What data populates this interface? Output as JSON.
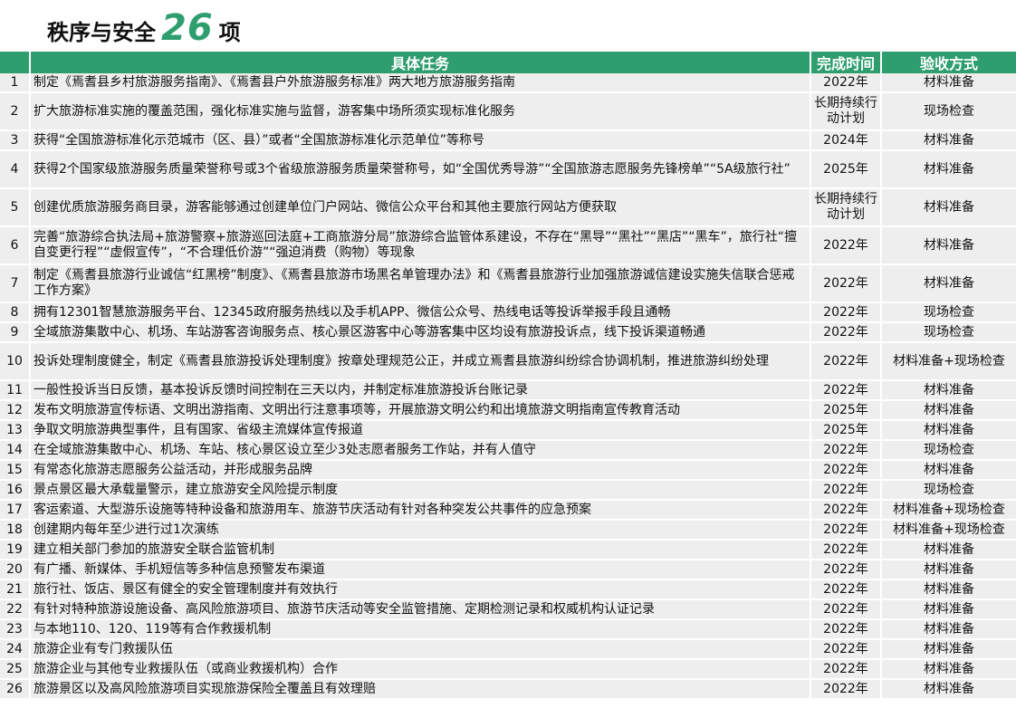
{
  "title": {
    "prefix": "秩序与安全",
    "number": "26",
    "suffix": "项"
  },
  "table": {
    "headers": {
      "index": "",
      "task": "具体任务",
      "time": "完成时间",
      "method": "验收方式"
    },
    "rows": [
      {
        "index": "1",
        "task": "制定《焉耆县乡村旅游服务指南》、《焉耆县户外旅游服务标准》两大地方旅游服务指南",
        "time": "2022年",
        "method": "材料准备"
      },
      {
        "index": "2",
        "task": "扩大旅游标准实施的覆盖范围，强化标准实施与监督，游客集中场所须实现标准化服务",
        "time": "长期持续行动计划",
        "method": "现场检查"
      },
      {
        "index": "3",
        "task": "获得“全国旅游标准化示范城市（区、县）”或者“全国旅游标准化示范单位”等称号",
        "time": "2024年",
        "method": "材料准备"
      },
      {
        "index": "4",
        "task": "获得2个国家级旅游服务质量荣誉称号或3个省级旅游服务质量荣誉称号，如“全国优秀导游”“全国旅游志愿服务先锋榜单”“5A级旅行社”",
        "time": "2025年",
        "method": "材料准备"
      },
      {
        "index": "5",
        "task": "创建优质旅游服务商目录，游客能够通过创建单位门户网站、微信公众平台和其他主要旅行网站方便获取",
        "time": "长期持续行动计划",
        "method": "材料准备"
      },
      {
        "index": "6",
        "task": "完善“旅游综合执法局+旅游警察+旅游巡回法庭+工商旅游分局”旅游综合监管体系建设，不存在“黑导”“黑社”“黑店”“黑车”，旅行社“擅自变更行程”“虚假宣传”，“不合理低价游”“强迫消费（购物）等现象",
        "time": "2022年",
        "method": "材料准备"
      },
      {
        "index": "7",
        "task": "制定《焉耆县旅游行业诚信“红黑榜”制度》、《焉耆县旅游市场黑名单管理办法》和《焉耆县旅游行业加强旅游诚信建设实施失信联合惩戒工作方案》",
        "time": "2022年",
        "method": "材料准备"
      },
      {
        "index": "8",
        "task": "拥有12301智慧旅游服务平台、12345政府服务热线以及手机APP、微信公众号、热线电话等投诉举报手段且通畅",
        "time": "2022年",
        "method": "现场检查"
      },
      {
        "index": "9",
        "task": "全域旅游集散中心、机场、车站游客咨询服务点、核心景区游客中心等游客集中区均设有旅游投诉点，线下投诉渠道畅通",
        "time": "2022年",
        "method": "现场检查"
      },
      {
        "index": "10",
        "task": "投诉处理制度健全，制定《焉耆县旅游投诉处理制度》按章处理规范公正，并成立焉耆县旅游纠纷综合协调机制，推进旅游纠纷处理",
        "time": "2022年",
        "method": "材料准备+现场检查"
      },
      {
        "index": "11",
        "task": "一般性投诉当日反馈，基本投诉反馈时间控制在三天以内，并制定标准旅游投诉台账记录",
        "time": "2022年",
        "method": "材料准备"
      },
      {
        "index": "12",
        "task": "发布文明旅游宣传标语、文明出游指南、文明出行注意事项等，开展旅游文明公约和出境旅游文明指南宣传教育活动",
        "time": "2025年",
        "method": "材料准备"
      },
      {
        "index": "13",
        "task": "争取文明旅游典型事件，且有国家、省级主流媒体宣传报道",
        "time": "2025年",
        "method": "材料准备"
      },
      {
        "index": "14",
        "task": "在全域旅游集散中心、机场、车站、核心景区设立至少3处志愿者服务工作站，并有人值守",
        "time": "2022年",
        "method": "现场检查"
      },
      {
        "index": "15",
        "task": "有常态化旅游志愿服务公益活动，并形成服务品牌",
        "time": "2022年",
        "method": "材料准备"
      },
      {
        "index": "16",
        "task": "景点景区最大承载量警示，建立旅游安全风险提示制度",
        "time": "2022年",
        "method": "现场检查"
      },
      {
        "index": "17",
        "task": "客运索道、大型游乐设施等特种设备和旅游用车、旅游节庆活动有针对各种突发公共事件的应急预案",
        "time": "2022年",
        "method": "材料准备+现场检查"
      },
      {
        "index": "18",
        "task": "创建期内每年至少进行过1次演练",
        "time": "2022年",
        "method": "材料准备+现场检查"
      },
      {
        "index": "19",
        "task": "建立相关部门参加的旅游安全联合监管机制",
        "time": "2022年",
        "method": "材料准备"
      },
      {
        "index": "20",
        "task": "有广播、新媒体、手机短信等多种信息预警发布渠道",
        "time": "2022年",
        "method": "材料准备"
      },
      {
        "index": "21",
        "task": "旅行社、饭店、景区有健全的安全管理制度并有效执行",
        "time": "2022年",
        "method": "材料准备"
      },
      {
        "index": "22",
        "task": "有针对特种旅游设施设备、高风险旅游项目、旅游节庆活动等安全监管措施、定期检测记录和权威机构认证记录",
        "time": "2022年",
        "method": "材料准备"
      },
      {
        "index": "23",
        "task": "与本地110、120、119等有合作救援机制",
        "time": "2022年",
        "method": "材料准备"
      },
      {
        "index": "24",
        "task": "旅游企业有专门救援队伍",
        "time": "2022年",
        "method": "材料准备"
      },
      {
        "index": "25",
        "task": "旅游企业与其他专业救援队伍（或商业救援机构）合作",
        "time": "2022年",
        "method": "材料准备"
      },
      {
        "index": "26",
        "task": "旅游景区以及高风险旅游项目实现旅游保险全覆盖且有效理赔",
        "time": "2022年",
        "method": "材料准备"
      }
    ]
  }
}
